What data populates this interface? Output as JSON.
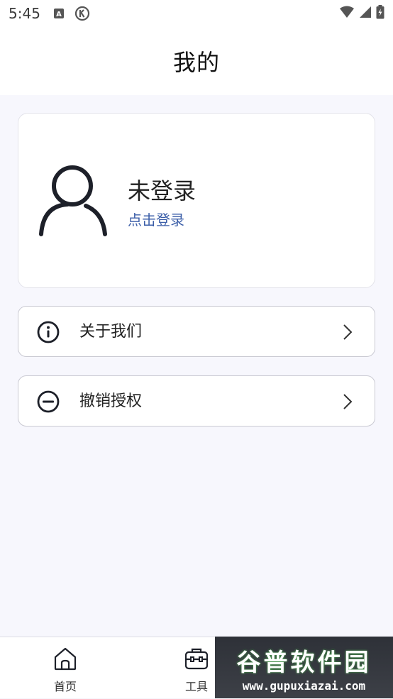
{
  "status_bar": {
    "time": "5:45",
    "icons": [
      "a-badge-icon",
      "k-circle-icon",
      "wifi-icon",
      "signal-icon",
      "battery-icon"
    ]
  },
  "header": {
    "title": "我的"
  },
  "profile": {
    "name": "未登录",
    "login_link": "点击登录",
    "avatar_icon": "user-outline-icon"
  },
  "menu": [
    {
      "label": "关于我们",
      "icon": "info-circle-icon"
    },
    {
      "label": "撤销授权",
      "icon": "minus-circle-icon"
    }
  ],
  "tabbar": {
    "tabs": [
      {
        "label": "首页",
        "icon": "home-icon"
      },
      {
        "label": "工具",
        "icon": "toolbox-icon"
      }
    ]
  },
  "watermark": {
    "title": "谷普软件园",
    "url": "www.gupuxiazai.com"
  },
  "colors": {
    "link": "#3b5ea8",
    "background": "#f7f7fd",
    "card": "#ffffff"
  }
}
